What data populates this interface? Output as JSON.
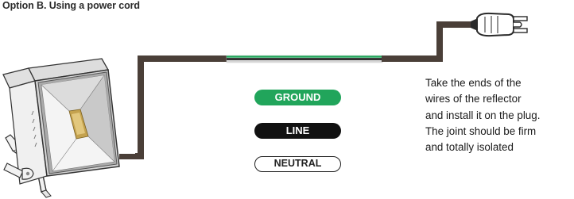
{
  "title": "Option B. Using a power cord",
  "badges": {
    "ground": "GROUND",
    "line": "LINE",
    "neutral": "NEUTRAL"
  },
  "instructions": [
    "Take the ends of the",
    "wires of the reflector",
    "and install it on the plug.",
    "The joint should be firm",
    "and totally isolated"
  ],
  "colors": {
    "cord": "#4a3f38",
    "ground": "#21a55b",
    "line": "#111111",
    "neutral": "#ffffff"
  },
  "icons": [
    "floodlight-icon",
    "power-plug-icon"
  ]
}
